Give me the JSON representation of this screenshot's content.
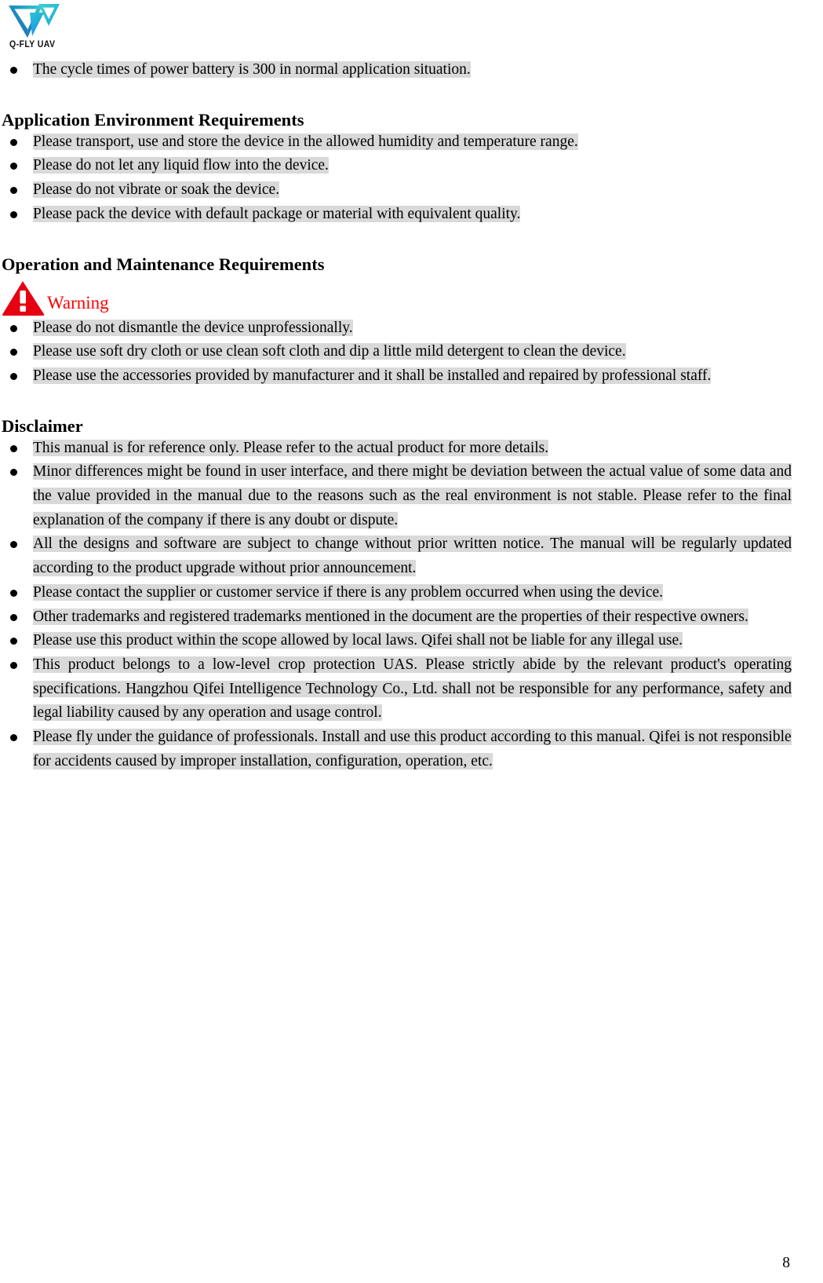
{
  "logo": {
    "name": "q-fly-uav-logo",
    "wordmark": "Q-FLY UAV",
    "colors": {
      "dark_blue": "#1b6fa8",
      "teal": "#35c3bd",
      "bright_blue": "#1aa7e0"
    }
  },
  "intro_bullets": [
    "The cycle times of power battery is 300 in normal application situation."
  ],
  "sections": [
    {
      "heading": "Application Environment Requirements",
      "bullets": [
        "Please transport, use and store the device in the allowed humidity and temperature range.",
        "Please do not let any liquid flow into the device.",
        "Please do not vibrate or soak the device.",
        "Please pack the device with default package or material with equivalent quality."
      ]
    },
    {
      "heading": "Operation and Maintenance Requirements",
      "warning": {
        "icon": "warning-triangle-icon",
        "label": "Warning",
        "color": "#ff0000"
      },
      "bullets": [
        "Please do not dismantle the device unprofessionally.",
        "Please use soft dry cloth or use clean soft cloth and dip a little mild detergent to clean the device.",
        "Please use the accessories provided by manufacturer and it shall be installed and repaired by professional staff."
      ]
    },
    {
      "heading": "Disclaimer",
      "bullets": [
        "This manual is for reference only. Please refer to the actual product for more details.",
        "Minor differences might be found in user interface, and there might be deviation between the actual value of some data and the value provided in the manual due to the reasons such as the real environment is not stable. Please refer to the final explanation of the company if there is any doubt or dispute.",
        "All the designs and software are subject to change without prior written notice. The manual will be regularly updated according to the product upgrade without prior announcement.",
        "Please contact the supplier or customer service if there is any problem occurred when using the device.",
        "Other trademarks and registered trademarks mentioned in the document are the properties of their respective owners.",
        "Please use this product within the scope allowed by local laws. Qifei shall not be liable for any illegal use.",
        "This product belongs to a low-level crop protection UAS. Please strictly abide by the relevant product's operating specifications. Hangzhou Qifei Intelligence Technology Co., Ltd. shall not be responsible for any performance, safety and legal liability caused by any operation and usage control.",
        "Please fly under the guidance of professionals. Install and use this product according to this manual. Qifei is not responsible for accidents caused by improper installation, configuration, operation, etc."
      ]
    }
  ],
  "footer": {
    "page_number": "8"
  }
}
